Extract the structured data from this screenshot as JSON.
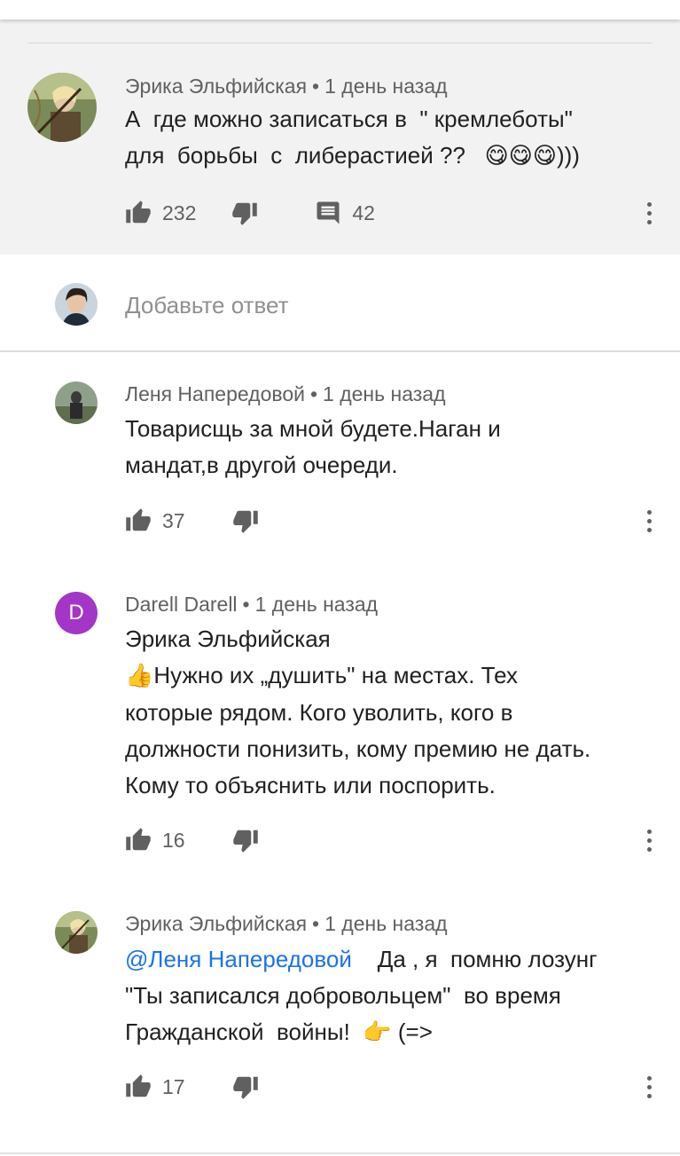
{
  "main_comment": {
    "author": "Эрика Эльфийская",
    "separator": "•",
    "time": "1 день назад",
    "text_line1": "А  где можно записаться в  \" кремлеботы\"",
    "text_line2": "для  борьбы  с  либерастией ??   ",
    "emoji": "😋😋😋",
    "text_tail": ")))",
    "likes": "232",
    "replies": "42"
  },
  "reply_box": {
    "placeholder": "Добавьте ответ"
  },
  "replies": [
    {
      "author": "Леня Напередовой",
      "separator": "•",
      "time": "1 день назад",
      "lines": [
        "Товарисщь за мной будете.Наган и",
        "мандат,в другой очереди."
      ],
      "likes": "37"
    },
    {
      "author": "Darell Darell",
      "avatar_letter": "D",
      "separator": "•",
      "time": "1 день назад",
      "line1": "Эрика Эльфийская",
      "thumb_emoji": "👍",
      "line2": "Нужно их „душить\" на местах. Тех",
      "lines_rest": [
        "которые рядом. Кого уволить, кого в",
        "должности понизить, кому премию не дать.",
        "Кому то объяснить или поспорить."
      ],
      "likes": "16"
    },
    {
      "author": "Эрика Эльфийская",
      "separator": "•",
      "time": "1 день назад",
      "mention": "@Леня Напередовой",
      "line1_rest": "    Да , я  помню лозунг",
      "line2": "\"Ты записался добровольцем\"  во время",
      "line3": "Гражданской  войны!  ",
      "point_emoji": "👉",
      "line3_tail": " (=>",
      "likes": "17"
    }
  ],
  "colors": {
    "text": "#212121",
    "meta": "#606060",
    "mention": "#1a73e8",
    "avatar_letter_bg": "#a336c7",
    "main_bg": "#f2f2f2"
  },
  "icons": [
    "thumb-up-icon",
    "thumb-down-icon",
    "comment-icon",
    "more-vert-icon"
  ]
}
